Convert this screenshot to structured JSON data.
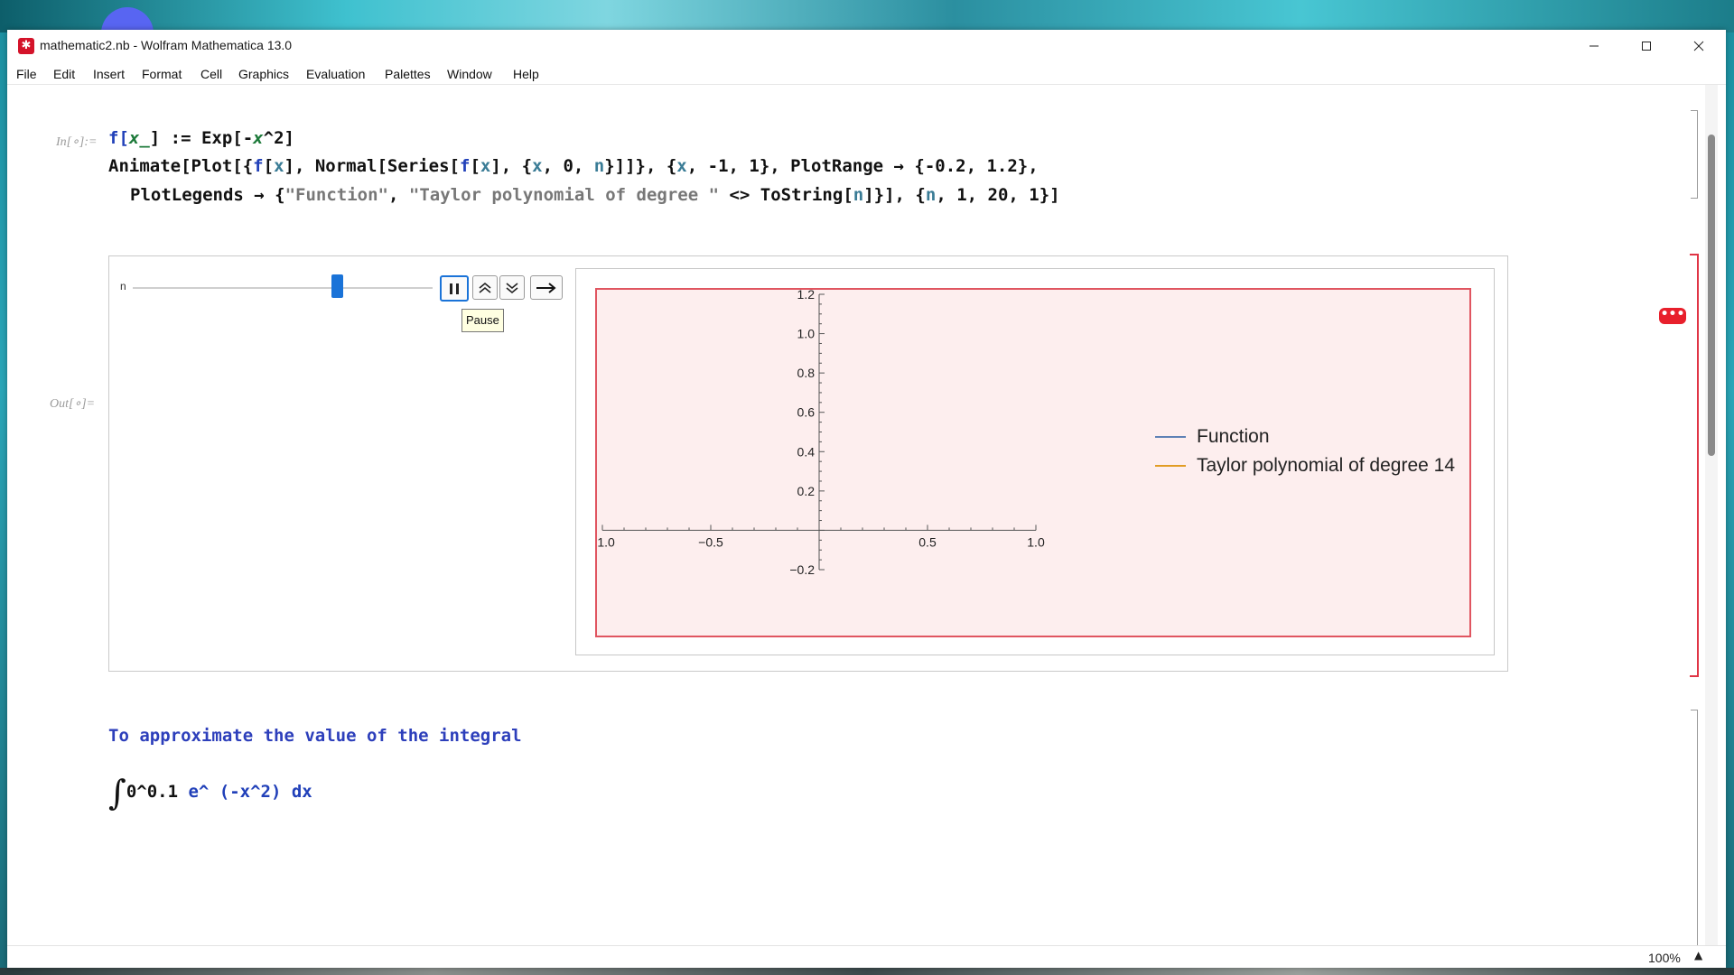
{
  "window": {
    "title": "mathematic2.nb - Wolfram Mathematica 13.0"
  },
  "menu": [
    "File",
    "Edit",
    "Insert",
    "Format",
    "Cell",
    "Graphics",
    "Evaluation",
    "Palettes",
    "Window",
    "Help"
  ],
  "cell_labels": {
    "input": "In[∘]:=",
    "output": "Out[∘]="
  },
  "input_code": {
    "line1": [
      "f[",
      "x_",
      "] := Exp[-",
      "x",
      "^2]"
    ],
    "line2": [
      "Animate[Plot[{",
      "f",
      "[",
      "x",
      "], Normal[Series[",
      "f",
      "[",
      "x",
      "], {",
      "x",
      ", 0, ",
      "n",
      "}]]}, {",
      "x",
      ", -1, 1}, PlotRange → {-0.2, 1.2},"
    ],
    "line3": [
      "PlotLegends → {",
      "\"Function\"",
      ", ",
      "\"Taylor polynomial of degree \"",
      " <> ToString[",
      "n",
      "]}], {",
      "n",
      ", 1, 20, 1}]"
    ]
  },
  "animator": {
    "variable_label": "n",
    "value_fraction": 0.68,
    "tooltip": "Pause",
    "buttons": [
      "pause",
      "faster",
      "slower",
      "direction"
    ]
  },
  "chart_data": {
    "type": "line",
    "x_ticks": [
      "-1.0",
      "-0.5",
      "0.5",
      "1.0"
    ],
    "y_ticks": [
      "1.2",
      "1.0",
      "0.8",
      "0.6",
      "0.4",
      "0.2",
      "-0.2"
    ],
    "xlim": [
      -1,
      1
    ],
    "ylim": [
      -0.2,
      1.2
    ],
    "series": [
      {
        "name": "Function",
        "color": "#5e81b5"
      },
      {
        "name": "Taylor polynomial of degree 14",
        "color": "#e19c24"
      }
    ],
    "legend_position": "right"
  },
  "text_cell": "To approximate the value of the integral",
  "integral_cell": {
    "sign": "∫",
    "body": "0^0.1",
    "tail": " e^ (-x^2) dx"
  },
  "status": {
    "zoom": "100%"
  },
  "badges": {
    "messages": "•••"
  }
}
